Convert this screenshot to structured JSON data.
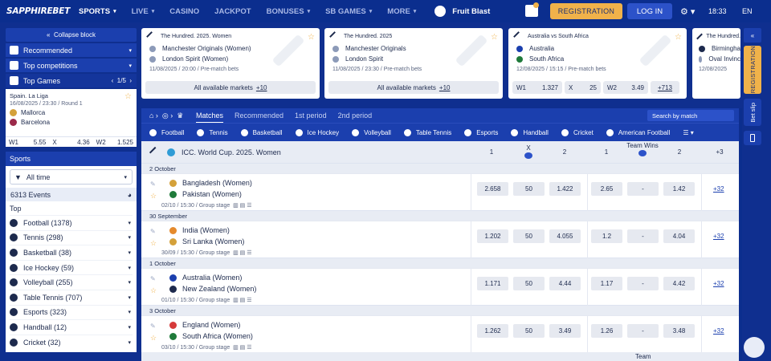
{
  "brand": "SAPPHIREBET",
  "nav": [
    {
      "label": "SPORTS",
      "chevron": true,
      "active": true
    },
    {
      "label": "LIVE",
      "chevron": true,
      "active": false
    },
    {
      "label": "CASINO",
      "chevron": false,
      "active": false
    },
    {
      "label": "JACKPOT",
      "chevron": false,
      "active": false
    },
    {
      "label": "BONUSES",
      "chevron": true,
      "active": false
    },
    {
      "label": "SB GAMES",
      "chevron": true,
      "active": false
    },
    {
      "label": "MORE",
      "chevron": true,
      "active": false
    }
  ],
  "fruit_label": "Fruit Blast",
  "registration_label": "REGISTRATION",
  "login_label": "LOG IN",
  "time": "18:33",
  "language": "EN",
  "sidebar": {
    "collapse": "Collapse block",
    "recommended": "Recommended",
    "top_competitions": "Top competitions",
    "top_games": "Top Games",
    "pager": "1/5",
    "top_game": {
      "league": "Spain. La Liga",
      "date": "16/08/2025 / 23:30 / Round 1",
      "team1": "Mallorca",
      "team2": "Barcelona",
      "odds": [
        {
          "k": "W1",
          "v": "5.55"
        },
        {
          "k": "X",
          "v": "4.36"
        },
        {
          "k": "W2",
          "v": "1.525"
        }
      ]
    },
    "sports_title": "Sports",
    "period": "All time",
    "events": "6313 Events",
    "top_label": "Top",
    "sports": [
      {
        "label": "Football (1378)"
      },
      {
        "label": "Tennis (298)"
      },
      {
        "label": "Basketball (38)"
      },
      {
        "label": "Ice Hockey (59)"
      },
      {
        "label": "Volleyball (255)"
      },
      {
        "label": "Table Tennis (707)"
      },
      {
        "label": "Esports (323)"
      },
      {
        "label": "Handball (12)"
      },
      {
        "label": "Cricket (32)"
      }
    ]
  },
  "cards": [
    {
      "league": "The Hundred. 2025. Women",
      "team1": "Manchester Originals (Women)",
      "team2": "London Spirit (Women)",
      "meta": "11/08/2025 / 20:00 / Pre-match bets",
      "all_markets": "All available markets",
      "more": "+10"
    },
    {
      "league": "The Hundred. 2025",
      "team1": "Manchester Originals",
      "team2": "London Spirit",
      "meta": "11/08/2025 / 23:30 / Pre-match bets",
      "all_markets": "All available markets",
      "more": "+10"
    },
    {
      "league": "Australia vs South Africa",
      "team1": "Australia",
      "team2": "South Africa",
      "meta": "12/08/2025 / 15:15 / Pre-match bets",
      "odds": [
        {
          "k": "W1",
          "v": "1.327"
        },
        {
          "k": "X",
          "v": "25"
        },
        {
          "k": "W2",
          "v": "3.49"
        }
      ],
      "more": "+713"
    },
    {
      "league": "The Hundred.",
      "team1": "Birmingha",
      "team2": "Oval Invinc",
      "meta": "12/08/2025"
    }
  ],
  "subnav": {
    "tabs": [
      "Matches",
      "Recommended",
      "1st period",
      "2nd period"
    ],
    "search": "Search by match"
  },
  "sportsbar": [
    "Football",
    "Tennis",
    "Basketball",
    "Ice Hockey",
    "Volleyball",
    "Table Tennis",
    "Esports",
    "Handball",
    "Cricket",
    "American Football"
  ],
  "league": {
    "name": "ICC. World Cup. 2025. Women",
    "cols": [
      "1",
      "X",
      "2",
      "1",
      "Team Wins",
      "2",
      "+3"
    ]
  },
  "matches": [
    {
      "date": "2 October",
      "team1": "Bangladesh (Women)",
      "team2": "Pakistan (Women)",
      "info": "02/10 / 15:30 / Group stage",
      "odds": [
        "2.658",
        "50",
        "1.422",
        "2.65",
        "-",
        "1.42"
      ],
      "more": "+32",
      "c1": "#1f7a3a",
      "c2": "#1f7a3a"
    },
    {
      "date": "30 September",
      "team1": "India (Women)",
      "team2": "Sri Lanka (Women)",
      "info": "30/09 / 15:30 / Group stage",
      "odds": [
        "1.202",
        "50",
        "4.055",
        "1.2",
        "-",
        "4.04"
      ],
      "more": "+32",
      "c1": "#e58a2c",
      "c2": "#d4a13a"
    },
    {
      "date": "1 October",
      "team1": "Australia (Women)",
      "team2": "New Zealand (Women)",
      "info": "01/10 / 15:30 / Group stage",
      "odds": [
        "1.171",
        "50",
        "4.44",
        "1.17",
        "-",
        "4.42"
      ],
      "more": "+32",
      "c1": "#1b3fae",
      "c2": "#1d2a4d"
    },
    {
      "date": "3 October",
      "team1": "England (Women)",
      "team2": "South Africa (Women)",
      "info": "03/10 / 15:30 / Group stage",
      "odds": [
        "1.262",
        "50",
        "3.49",
        "1.26",
        "-",
        "3.48"
      ],
      "more": "+32",
      "c1": "#d63a3a",
      "c2": "#1f7a3a"
    }
  ],
  "next_header": "Team",
  "rail": {
    "registration": "REGISTRATION",
    "betslip": "Bet slip"
  }
}
